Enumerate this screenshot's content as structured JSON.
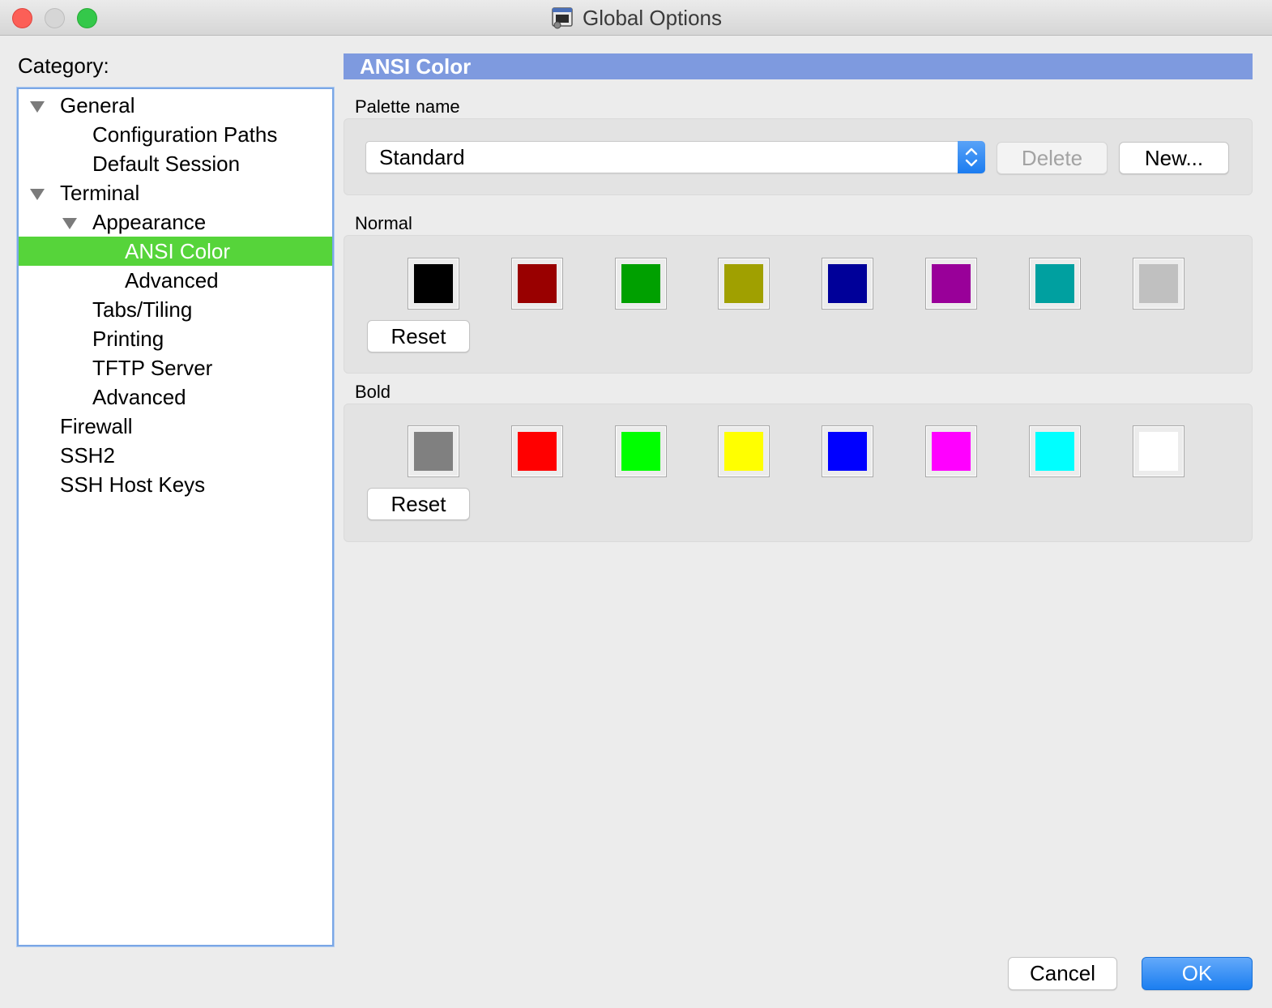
{
  "window": {
    "title": "Global Options"
  },
  "sidebar": {
    "category_label": "Category:",
    "items": [
      {
        "label": "General",
        "expanded": true
      },
      {
        "label": "Configuration Paths"
      },
      {
        "label": "Default Session"
      },
      {
        "label": "Terminal",
        "expanded": true
      },
      {
        "label": "Appearance",
        "expanded": true
      },
      {
        "label": "ANSI Color",
        "selected": true
      },
      {
        "label": "Advanced"
      },
      {
        "label": "Tabs/Tiling"
      },
      {
        "label": "Printing"
      },
      {
        "label": "TFTP Server"
      },
      {
        "label": "Advanced"
      },
      {
        "label": "Firewall"
      },
      {
        "label": "SSH2"
      },
      {
        "label": "SSH Host Keys"
      }
    ]
  },
  "panel": {
    "header": "ANSI Color",
    "palette": {
      "label": "Palette name",
      "selected": "Standard",
      "delete_label": "Delete",
      "new_label": "New..."
    },
    "normal": {
      "label": "Normal",
      "colors": [
        "#000000",
        "#990000",
        "#00a000",
        "#a0a000",
        "#000099",
        "#990099",
        "#00a0a0",
        "#c0c0c0"
      ],
      "reset_label": "Reset"
    },
    "bold": {
      "label": "Bold",
      "colors": [
        "#808080",
        "#ff0000",
        "#00ff00",
        "#ffff00",
        "#0000ff",
        "#ff00ff",
        "#00ffff",
        "#ffffff"
      ],
      "reset_label": "Reset"
    }
  },
  "footer": {
    "cancel_label": "Cancel",
    "ok_label": "OK"
  },
  "accent": {
    "selection": "#56d43a",
    "header": "#7e9adf",
    "primary": "#1b7ef0"
  }
}
